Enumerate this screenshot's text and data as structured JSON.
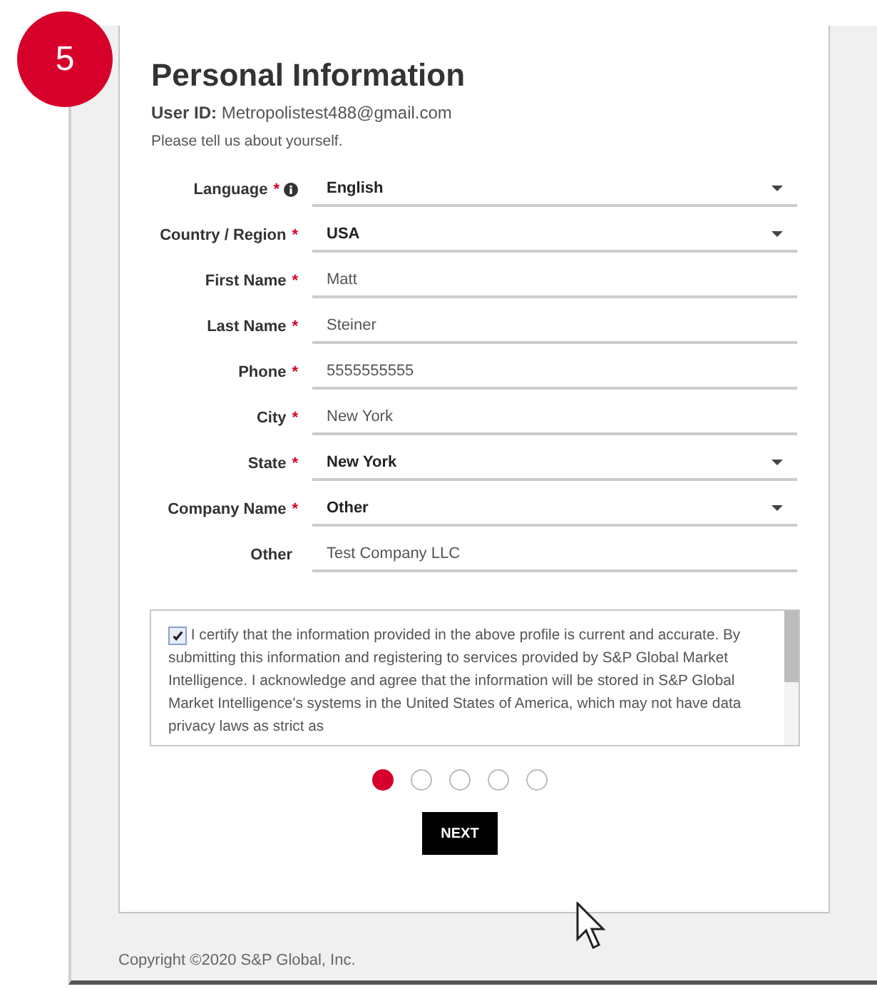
{
  "step_badge": "5",
  "title": "Personal Information",
  "user_id": {
    "label": "User ID:",
    "value": "Metropolistest488@gmail.com"
  },
  "intro": "Please tell us about yourself.",
  "fields": [
    {
      "label": "Language",
      "kind": "select",
      "required": true,
      "info": true,
      "value": "English"
    },
    {
      "label": "Country / Region",
      "kind": "select",
      "required": true,
      "info": false,
      "value": "USA"
    },
    {
      "label": "First Name",
      "kind": "text",
      "required": true,
      "info": false,
      "value": "Matt"
    },
    {
      "label": "Last Name",
      "kind": "text",
      "required": true,
      "info": false,
      "value": "Steiner"
    },
    {
      "label": "Phone",
      "kind": "text",
      "required": true,
      "info": false,
      "value": "5555555555"
    },
    {
      "label": "City",
      "kind": "text",
      "required": true,
      "info": false,
      "value": "New York"
    },
    {
      "label": "State",
      "kind": "select",
      "required": true,
      "info": false,
      "value": "New York"
    },
    {
      "label": "Company Name",
      "kind": "select",
      "required": true,
      "info": false,
      "value": "Other"
    },
    {
      "label": "Other",
      "kind": "text",
      "required": false,
      "info": false,
      "value": "Test Company LLC"
    }
  ],
  "required_mark": "*",
  "certification": {
    "checked": true,
    "text": "I certify that the information provided in the above profile is current and accurate. By submitting this information and registering to services provided by S&P Global Market Intelligence. I acknowledge and agree that the information will be stored in S&P Global Market Intelligence's systems in the United States of America, which may not have data privacy laws as strict as"
  },
  "steps": [
    {
      "selected": true
    },
    {
      "selected": false
    },
    {
      "selected": false
    },
    {
      "selected": false
    },
    {
      "selected": false
    }
  ],
  "next_button": "NEXT",
  "copyright": "Copyright ©2020 S&P Global, Inc."
}
